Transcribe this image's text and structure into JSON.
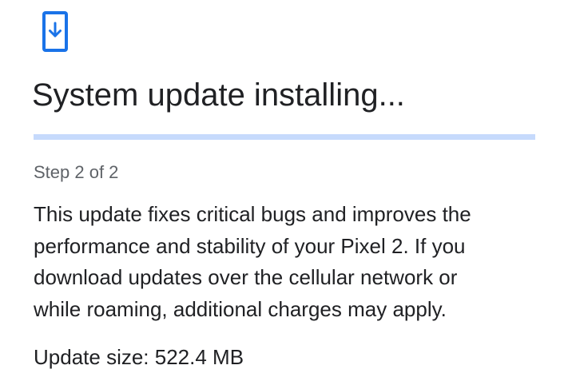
{
  "header": {
    "icon": "system-update-download-icon",
    "title": "System update installing..."
  },
  "progress": {
    "value": 0,
    "state": "indeterminate",
    "track_color": "#c6dafc",
    "accent_color": "#1a73e8"
  },
  "content": {
    "step": "Step 2 of 2",
    "description_lines": [
      "This update fixes critical bugs and improves the",
      "performance and stability of your Pixel 2. If you",
      "download updates over the cellular network or",
      "while roaming, additional charges may apply."
    ],
    "update_size": "Update size: 522.4 MB"
  },
  "colors": {
    "icon_blue": "#1a73e8",
    "text_primary": "#202124",
    "text_secondary": "#5f6368"
  }
}
